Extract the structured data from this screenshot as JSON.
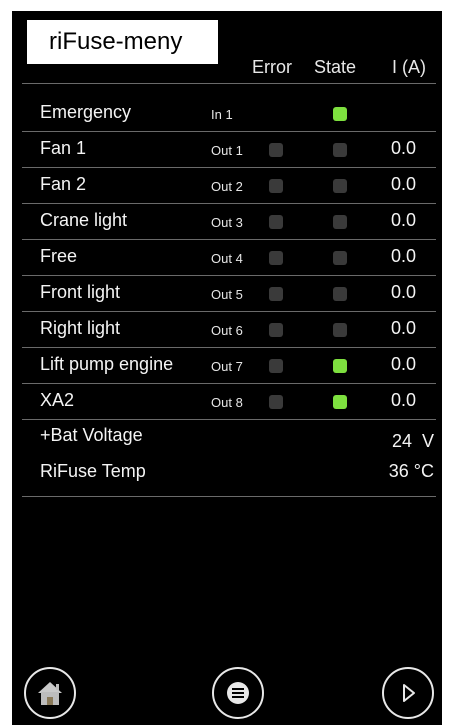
{
  "title": "riFuse-meny",
  "columns": {
    "error": "Error",
    "state": "State",
    "current": "I (A)"
  },
  "channels": [
    {
      "name": "Emergency",
      "port": "In 1",
      "error": null,
      "state": true,
      "current": ""
    },
    {
      "name": "Fan 1",
      "port": "Out 1",
      "error": false,
      "state": false,
      "current": "0.0"
    },
    {
      "name": "Fan 2",
      "port": "Out 2",
      "error": false,
      "state": false,
      "current": "0.0"
    },
    {
      "name": "Crane light",
      "port": "Out 3",
      "error": false,
      "state": false,
      "current": "0.0"
    },
    {
      "name": "Free",
      "port": "Out 4",
      "error": false,
      "state": false,
      "current": "0.0"
    },
    {
      "name": "Front light",
      "port": "Out 5",
      "error": false,
      "state": false,
      "current": "0.0"
    },
    {
      "name": "Right light",
      "port": "Out 6",
      "error": false,
      "state": false,
      "current": "0.0"
    },
    {
      "name": "Lift pump engine",
      "port": "Out 7",
      "error": false,
      "state": true,
      "current": "0.0"
    },
    {
      "name": "XA2",
      "port": "Out 8",
      "error": false,
      "state": true,
      "current": "0.0"
    }
  ],
  "battery": {
    "label": "+Bat Voltage",
    "value": "24  V"
  },
  "temperature": {
    "label": "RiFuse Temp",
    "value": "36 °C"
  },
  "nav": {
    "home": "home-icon",
    "menu": "menu-icon",
    "next": "next-icon"
  },
  "colors": {
    "state_on": "#7ee03f",
    "indicator_off": "#3a3a3a",
    "background": "#000000"
  }
}
